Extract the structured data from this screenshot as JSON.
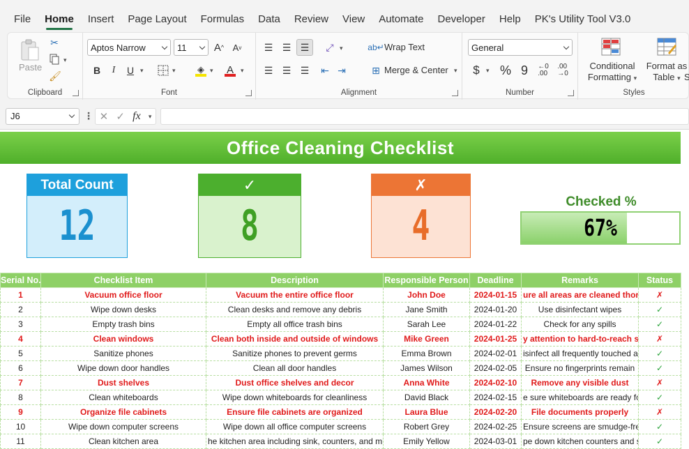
{
  "menu": [
    "File",
    "Home",
    "Insert",
    "Page Layout",
    "Formulas",
    "Data",
    "Review",
    "View",
    "Automate",
    "Developer",
    "Help",
    "PK's Utility Tool V3.0"
  ],
  "ribbon": {
    "clipboard": {
      "paste": "Paste",
      "label": "Clipboard"
    },
    "font": {
      "name": "Aptos Narrow",
      "size": "11",
      "label": "Font",
      "bold": "B",
      "italic": "I",
      "underline": "U"
    },
    "alignment": {
      "wrap": "Wrap Text",
      "merge": "Merge & Center",
      "label": "Alignment"
    },
    "number": {
      "format": "General",
      "currency": "$",
      "percent": "%",
      "comma": "9",
      "label": "Number"
    },
    "styles": {
      "conditional_line1": "Conditional",
      "conditional_line2": "Formatting",
      "format_table_line1": "Format as",
      "format_table_line2": "Table",
      "label": "Styles",
      "cut_off": "St"
    }
  },
  "formula_bar": {
    "cell_ref": "J6",
    "fx": "fx",
    "value": ""
  },
  "sheet": {
    "title": "Office Cleaning Checklist",
    "cards": {
      "total": {
        "label": "Total Count",
        "value": "12"
      },
      "checked": {
        "label": "✓",
        "value": "8"
      },
      "unchecked": {
        "label": "✗",
        "value": "4"
      }
    },
    "checked_pct": {
      "label": "Checked %",
      "value_text": "67%",
      "fraction": 0.67
    },
    "columns": [
      "Serial No.",
      "Checklist Item",
      "Description",
      "Responsible Person",
      "Deadline",
      "Remarks",
      "Status"
    ],
    "rows": [
      {
        "serial": "1",
        "item": "Vacuum office floor",
        "desc": "Vacuum the entire office floor",
        "person": "John Doe",
        "deadline": "2024-01-15",
        "remarks": "ure all areas are cleaned thorou",
        "status": "✗",
        "red": true
      },
      {
        "serial": "2",
        "item": "Wipe down desks",
        "desc": "Clean desks and remove any debris",
        "person": "Jane Smith",
        "deadline": "2024-01-20",
        "remarks": "Use disinfectant wipes",
        "status": "✓",
        "red": false
      },
      {
        "serial": "3",
        "item": "Empty trash bins",
        "desc": "Empty all office trash bins",
        "person": "Sarah Lee",
        "deadline": "2024-01-22",
        "remarks": "Check for any spills",
        "status": "✓",
        "red": false
      },
      {
        "serial": "4",
        "item": "Clean windows",
        "desc": "Clean both inside and outside of windows",
        "person": "Mike Green",
        "deadline": "2024-01-25",
        "remarks": "y attention to hard-to-reach spo",
        "status": "✗",
        "red": true
      },
      {
        "serial": "5",
        "item": "Sanitize phones",
        "desc": "Sanitize phones to prevent germs",
        "person": "Emma Brown",
        "deadline": "2024-02-01",
        "remarks": "isinfect all frequently touched are",
        "status": "✓",
        "red": false
      },
      {
        "serial": "6",
        "item": "Wipe down door handles",
        "desc": "Clean all door handles",
        "person": "James Wilson",
        "deadline": "2024-02-05",
        "remarks": "Ensure no fingerprints remain",
        "status": "✓",
        "red": false
      },
      {
        "serial": "7",
        "item": "Dust shelves",
        "desc": "Dust office shelves and decor",
        "person": "Anna White",
        "deadline": "2024-02-10",
        "remarks": "Remove any visible dust",
        "status": "✗",
        "red": true
      },
      {
        "serial": "8",
        "item": "Clean whiteboards",
        "desc": "Wipe down whiteboards for cleanliness",
        "person": "David Black",
        "deadline": "2024-02-15",
        "remarks": "e sure whiteboards are ready for",
        "status": "✓",
        "red": false
      },
      {
        "serial": "9",
        "item": "Organize file cabinets",
        "desc": "Ensure file cabinets are organized",
        "person": "Laura Blue",
        "deadline": "2024-02-20",
        "remarks": "File documents properly",
        "status": "✗",
        "red": true
      },
      {
        "serial": "10",
        "item": "Wipe down computer screens",
        "desc": "Wipe down all office computer screens",
        "person": "Robert Grey",
        "deadline": "2024-02-25",
        "remarks": "Ensure screens are smudge-free",
        "status": "✓",
        "red": false
      },
      {
        "serial": "11",
        "item": "Clean kitchen area",
        "desc": "he kitchen area including sink, counters, and mic",
        "person": "Emily Yellow",
        "deadline": "2024-03-01",
        "remarks": "pe down kitchen counters and si",
        "status": "✓",
        "red": false
      }
    ]
  },
  "colors": {
    "excel_green": "#217346",
    "banner": "#5bbd32",
    "blue_card": "#1ea0dc",
    "green_card": "#4caf2e",
    "orange_card": "#ec7535",
    "red_text": "#e01b1b",
    "check_green": "#2aa33a"
  }
}
